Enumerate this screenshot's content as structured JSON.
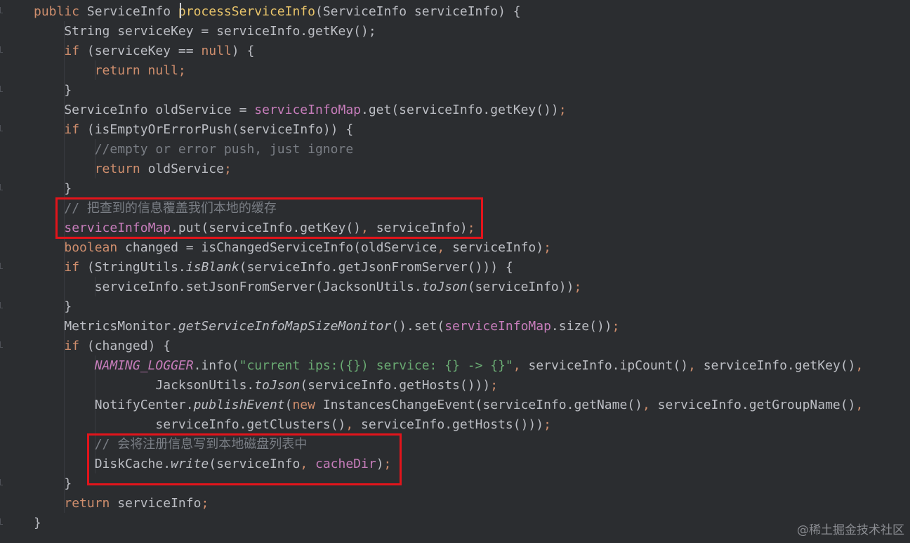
{
  "editor": {
    "theme_colors": {
      "background": "#2b2d30",
      "keyword": "#cf8e6d",
      "method": "#e8c46a",
      "field": "#c77dbb",
      "comment": "#7a7e85",
      "string": "#6aab73",
      "highlight": "#e3141b"
    },
    "lines": [
      {
        "id": "l1",
        "segments": [
          {
            "t": "public ",
            "c": "kw"
          },
          {
            "t": "ServiceInfo "
          },
          {
            "t": "processServiceInfo",
            "c": "fn"
          },
          {
            "t": "(ServiceInfo serviceInfo) {"
          }
        ]
      },
      {
        "id": "l2",
        "segments": [
          {
            "t": "    String serviceKey = serviceInfo.getKey();"
          }
        ]
      },
      {
        "id": "l3",
        "segments": [
          {
            "t": "    "
          },
          {
            "t": "if",
            "c": "kw"
          },
          {
            "t": " (serviceKey == "
          },
          {
            "t": "null",
            "c": "kw"
          },
          {
            "t": ") {"
          }
        ]
      },
      {
        "id": "l4",
        "segments": [
          {
            "t": "        "
          },
          {
            "t": "return null",
            "c": "kw"
          },
          {
            "t": ";",
            "c": "kw"
          }
        ]
      },
      {
        "id": "l5",
        "segments": [
          {
            "t": "    }"
          }
        ]
      },
      {
        "id": "l6",
        "segments": [
          {
            "t": "    ServiceInfo oldService = "
          },
          {
            "t": "serviceInfoMap",
            "c": "fld"
          },
          {
            "t": ".get(serviceInfo.getKey())"
          },
          {
            "t": ";",
            "c": "kw"
          }
        ]
      },
      {
        "id": "l7",
        "segments": [
          {
            "t": "    "
          },
          {
            "t": "if",
            "c": "kw"
          },
          {
            "t": " (isEmptyOrErrorPush(serviceInfo)) {"
          }
        ]
      },
      {
        "id": "l8",
        "segments": [
          {
            "t": "        "
          },
          {
            "t": "//empty or error push, just ignore",
            "c": "cmt"
          }
        ]
      },
      {
        "id": "l9",
        "segments": [
          {
            "t": "        "
          },
          {
            "t": "return",
            "c": "kw"
          },
          {
            "t": " oldService"
          },
          {
            "t": ";",
            "c": "kw"
          }
        ]
      },
      {
        "id": "l10",
        "segments": [
          {
            "t": "    }"
          }
        ]
      },
      {
        "id": "l11",
        "segments": [
          {
            "t": "    "
          },
          {
            "t": "// 把查到的信息覆盖我们本地的缓存",
            "c": "cmt"
          }
        ]
      },
      {
        "id": "l12",
        "segments": [
          {
            "t": "    "
          },
          {
            "t": "serviceInfoMap",
            "c": "fld"
          },
          {
            "t": ".put(serviceInfo.getKey()"
          },
          {
            "t": ", ",
            "c": "kw"
          },
          {
            "t": "serviceInfo)"
          },
          {
            "t": ";",
            "c": "kw"
          }
        ]
      },
      {
        "id": "l13",
        "segments": [
          {
            "t": "    "
          },
          {
            "t": "boolean",
            "c": "kw"
          },
          {
            "t": " changed = isChangedServiceInfo(oldService"
          },
          {
            "t": ", ",
            "c": "kw"
          },
          {
            "t": "serviceInfo)"
          },
          {
            "t": ";",
            "c": "kw"
          }
        ]
      },
      {
        "id": "l14",
        "segments": [
          {
            "t": "    "
          },
          {
            "t": "if",
            "c": "kw"
          },
          {
            "t": " (StringUtils."
          },
          {
            "t": "isBlank",
            "c": "it"
          },
          {
            "t": "(serviceInfo.getJsonFromServer())) {"
          }
        ]
      },
      {
        "id": "l15",
        "segments": [
          {
            "t": "        serviceInfo.setJsonFromServer(JacksonUtils."
          },
          {
            "t": "toJson",
            "c": "it"
          },
          {
            "t": "(serviceInfo))"
          },
          {
            "t": ";",
            "c": "kw"
          }
        ]
      },
      {
        "id": "l16",
        "segments": [
          {
            "t": "    }"
          }
        ]
      },
      {
        "id": "l17",
        "segments": [
          {
            "t": "    MetricsMonitor."
          },
          {
            "t": "getServiceInfoMapSizeMonitor",
            "c": "it"
          },
          {
            "t": "().set("
          },
          {
            "t": "serviceInfoMap",
            "c": "fld"
          },
          {
            "t": ".size())"
          },
          {
            "t": ";",
            "c": "kw"
          }
        ]
      },
      {
        "id": "l18",
        "segments": [
          {
            "t": "    "
          },
          {
            "t": "if",
            "c": "kw"
          },
          {
            "t": " (changed) {"
          }
        ]
      },
      {
        "id": "l19",
        "segments": [
          {
            "t": "        "
          },
          {
            "t": "NAMING_LOGGER",
            "c": "fld it"
          },
          {
            "t": ".info("
          },
          {
            "t": "\"current ips:({}) service: {} -> {}\"",
            "c": "str"
          },
          {
            "t": ", ",
            "c": "kw"
          },
          {
            "t": "serviceInfo.ipCount()"
          },
          {
            "t": ", ",
            "c": "kw"
          },
          {
            "t": "serviceInfo.getKey()"
          },
          {
            "t": ",",
            "c": "kw"
          }
        ]
      },
      {
        "id": "l20",
        "segments": [
          {
            "t": "                JacksonUtils."
          },
          {
            "t": "toJson",
            "c": "it"
          },
          {
            "t": "(serviceInfo.getHosts()))"
          },
          {
            "t": ";",
            "c": "kw"
          }
        ]
      },
      {
        "id": "l21",
        "segments": [
          {
            "t": "        NotifyCenter."
          },
          {
            "t": "publishEvent",
            "c": "it"
          },
          {
            "t": "("
          },
          {
            "t": "new",
            "c": "kw"
          },
          {
            "t": " InstancesChangeEvent(serviceInfo.getName()"
          },
          {
            "t": ", ",
            "c": "kw"
          },
          {
            "t": "serviceInfo.getGroupName()"
          },
          {
            "t": ",",
            "c": "kw"
          }
        ]
      },
      {
        "id": "l22",
        "segments": [
          {
            "t": "                serviceInfo.getClusters()"
          },
          {
            "t": ", ",
            "c": "kw"
          },
          {
            "t": "serviceInfo.getHosts()))"
          },
          {
            "t": ";",
            "c": "kw"
          }
        ]
      },
      {
        "id": "l23",
        "segments": [
          {
            "t": "        "
          },
          {
            "t": "// 会将注册信息写到本地磁盘列表中",
            "c": "cmt"
          }
        ]
      },
      {
        "id": "l24",
        "segments": [
          {
            "t": "        DiskCache."
          },
          {
            "t": "write",
            "c": "it"
          },
          {
            "t": "(serviceInfo"
          },
          {
            "t": ", ",
            "c": "kw"
          },
          {
            "t": "cacheDir",
            "c": "fld"
          },
          {
            "t": ")"
          },
          {
            "t": ";",
            "c": "kw"
          }
        ]
      },
      {
        "id": "l25",
        "segments": [
          {
            "t": "    }"
          }
        ]
      },
      {
        "id": "l26",
        "segments": [
          {
            "t": "    "
          },
          {
            "t": "return",
            "c": "kw"
          },
          {
            "t": " serviceInfo"
          },
          {
            "t": ";",
            "c": "kw"
          }
        ]
      },
      {
        "id": "l27",
        "segments": [
          {
            "t": "}"
          }
        ]
      }
    ],
    "annotations": [
      {
        "id": "box-cache-update",
        "label": "highlight-cache-update"
      },
      {
        "id": "box-disk-write",
        "label": "highlight-disk-write"
      }
    ]
  },
  "watermark": {
    "text": "@稀土掘金技术社区"
  }
}
